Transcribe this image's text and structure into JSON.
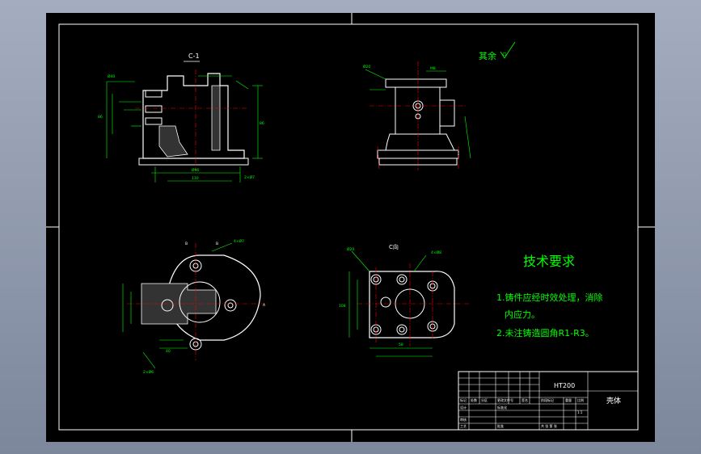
{
  "technical_requirements": {
    "title": "技术要求",
    "item1_line1": "1.铸件应经时效处理，消除",
    "item1_line2": "内应力。",
    "item2": "2.未注铸造圆角R1-R3。"
  },
  "surface_finish_note": "其余",
  "section_labels": {
    "top_left": "C-1",
    "bottom_right": "C向"
  },
  "title_block": {
    "material": "HT200",
    "part_name": "壳体"
  },
  "colors": {
    "sheet_bg": "#000000",
    "outline": "#ffffff",
    "dimension": "#00ff00",
    "centerline": "#ff0000",
    "part": "#ffffff"
  }
}
